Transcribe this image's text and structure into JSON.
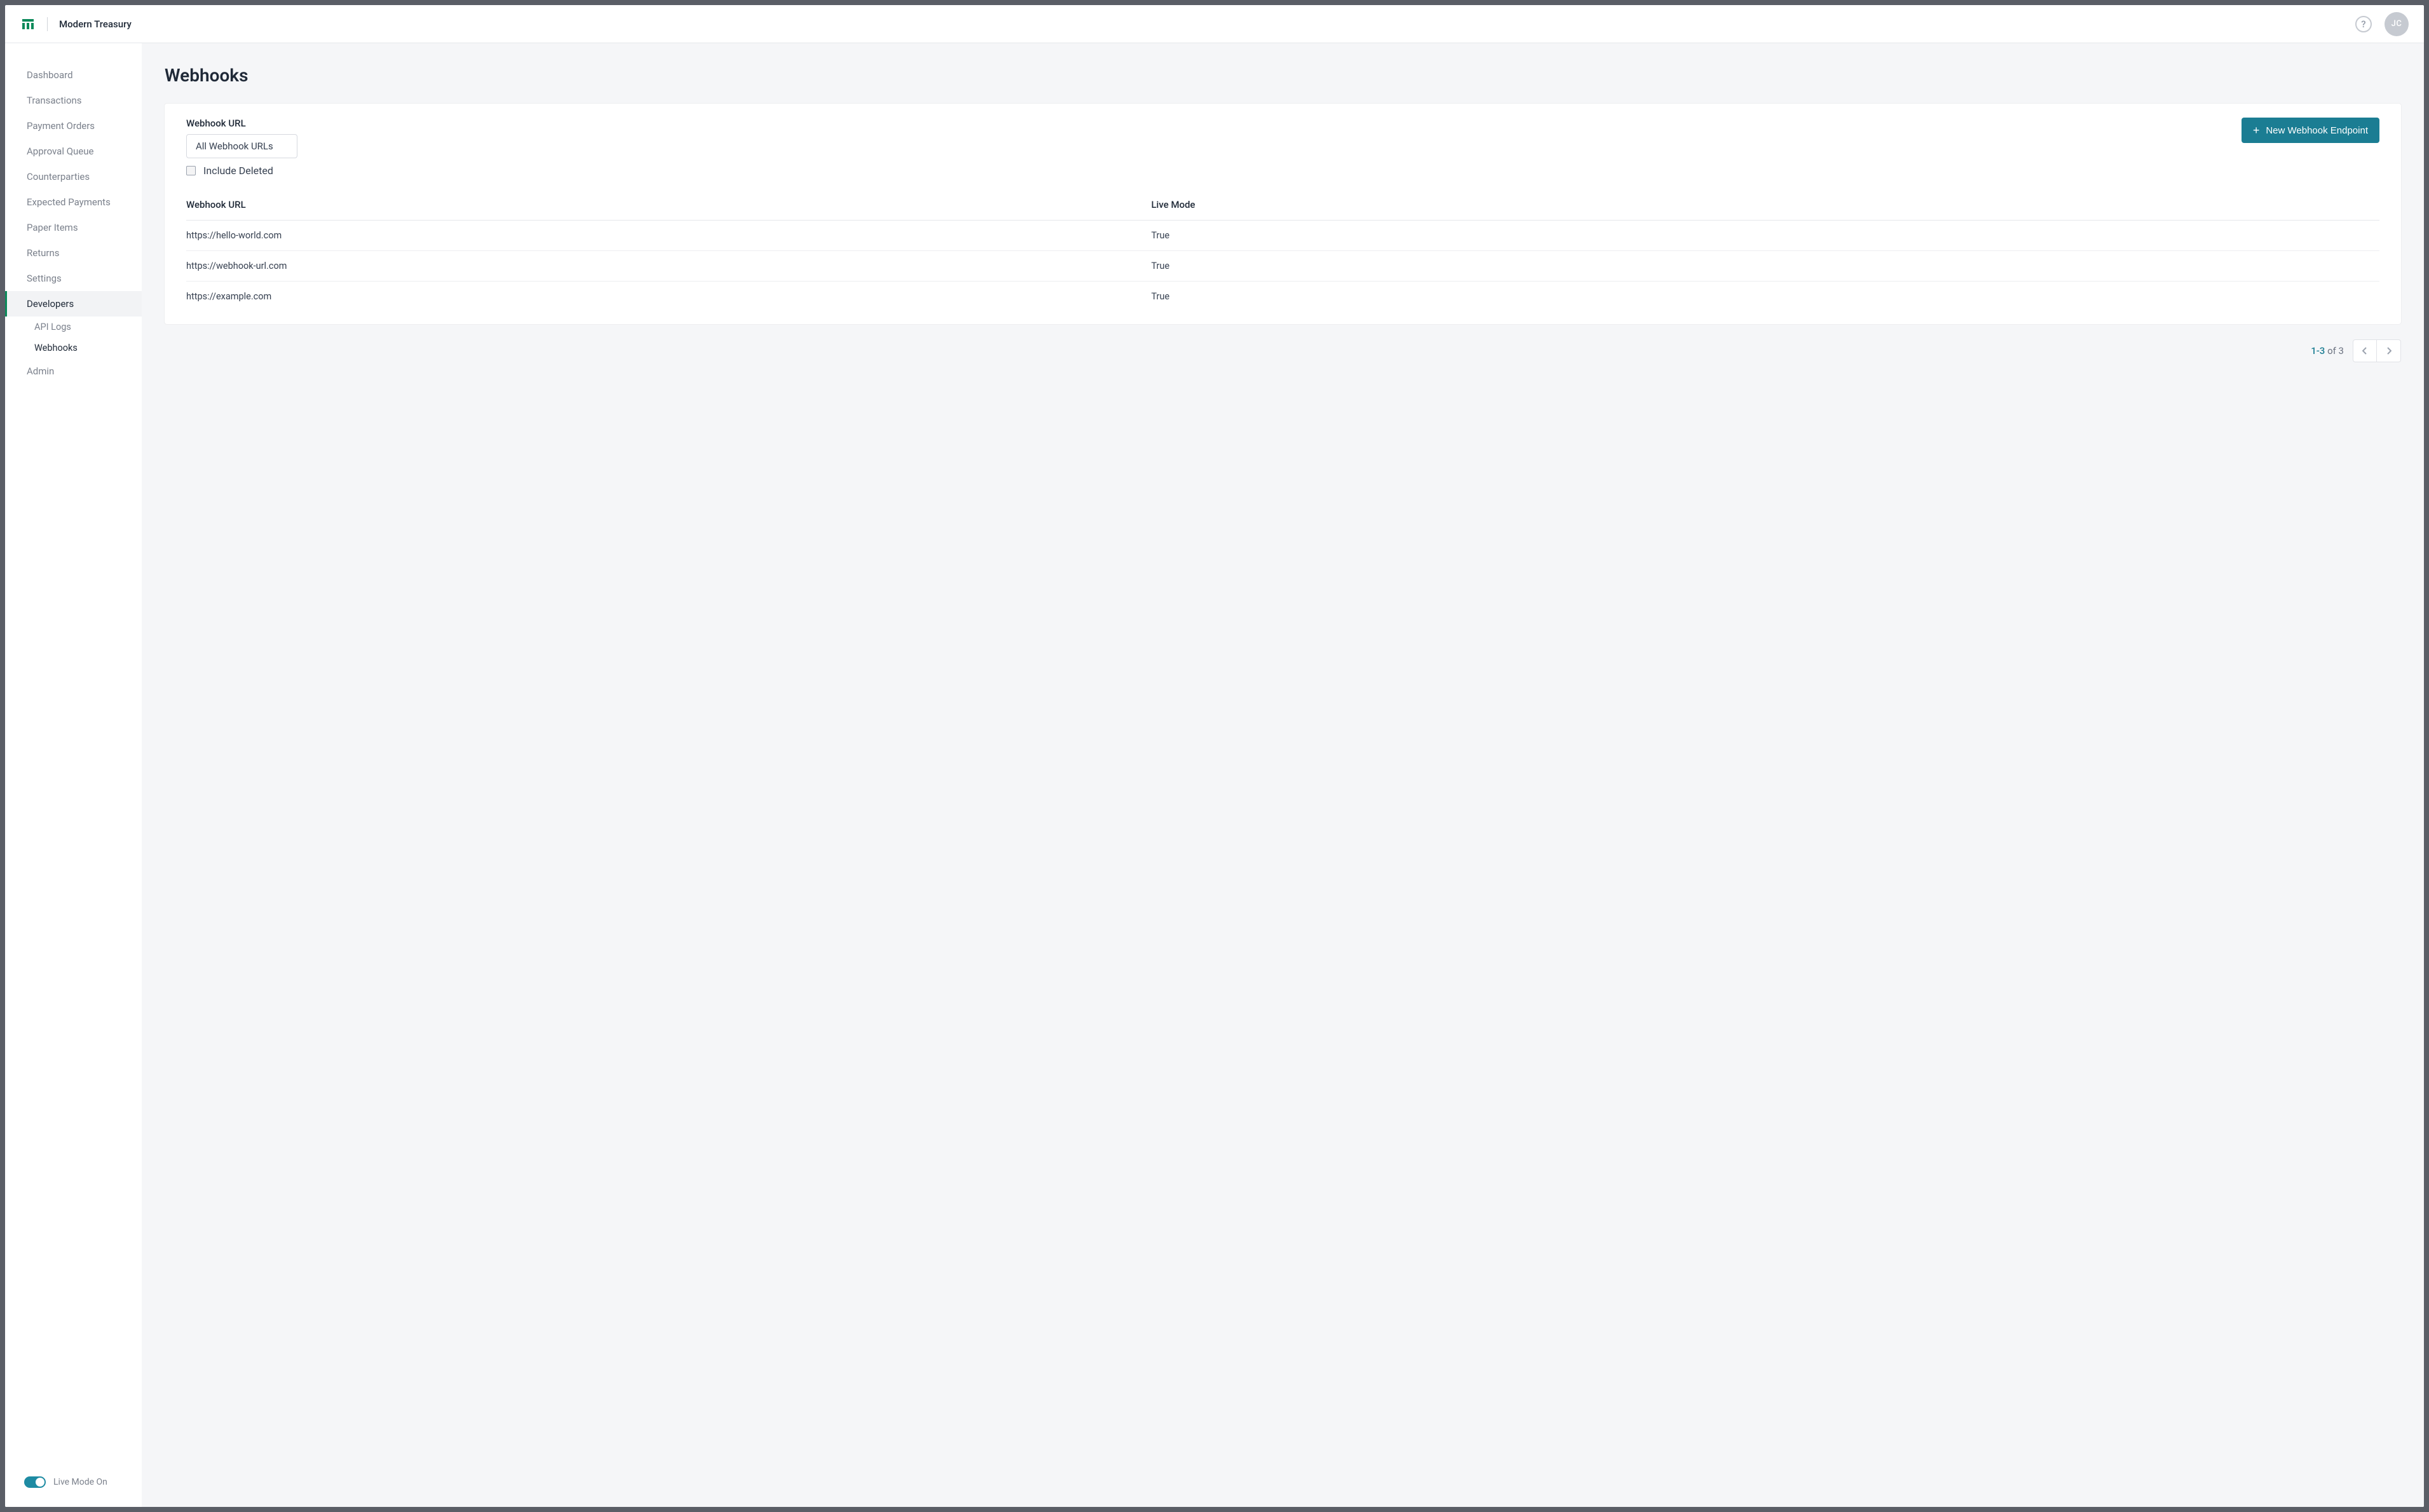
{
  "header": {
    "brand": "Modern Treasury",
    "avatar_initials": "JC",
    "help_symbol": "?"
  },
  "sidebar": {
    "items": [
      {
        "label": "Dashboard"
      },
      {
        "label": "Transactions"
      },
      {
        "label": "Payment Orders"
      },
      {
        "label": "Approval Queue"
      },
      {
        "label": "Counterparties"
      },
      {
        "label": "Expected Payments"
      },
      {
        "label": "Paper Items"
      },
      {
        "label": "Returns"
      },
      {
        "label": "Settings"
      },
      {
        "label": "Developers"
      },
      {
        "label": "Admin"
      }
    ],
    "sub_items": {
      "api_logs": "API Logs",
      "webhooks": "Webhooks"
    },
    "live_mode_label": "Live Mode On"
  },
  "main": {
    "page_title": "Webhooks",
    "filter_label": "Webhook URL",
    "filter_value": "All Webhook URLs",
    "include_deleted_label": "Include Deleted",
    "new_button_label": "New Webhook Endpoint",
    "columns": {
      "url": "Webhook URL",
      "live": "Live Mode"
    },
    "rows": [
      {
        "url": "https://hello-world.com",
        "live": "True"
      },
      {
        "url": "https://webhook-url.com",
        "live": "True"
      },
      {
        "url": "https://example.com",
        "live": "True"
      }
    ],
    "pagination": {
      "range": "1-3",
      "of_text": " of 3"
    }
  }
}
